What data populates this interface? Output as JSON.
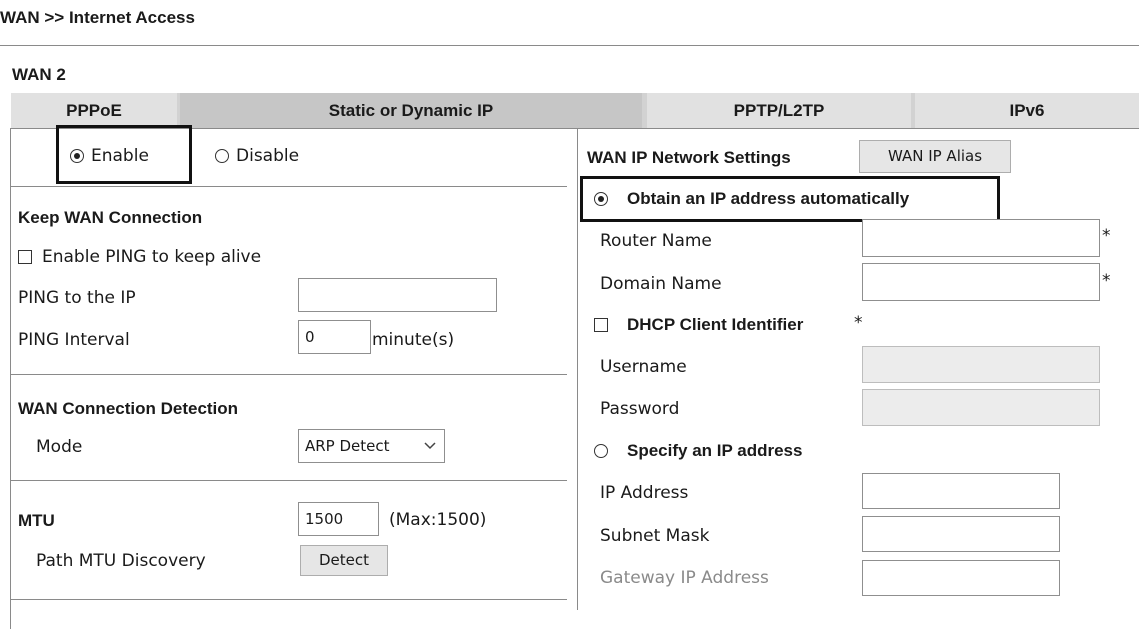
{
  "breadcrumb": "WAN >> Internet Access",
  "wan_label": "WAN 2",
  "tabs": [
    "PPPoE",
    "Static or Dynamic IP",
    "PPTP/L2TP",
    "IPv6"
  ],
  "enable_group": {
    "enable": "Enable",
    "disable": "Disable",
    "selected": "Enable"
  },
  "keep_wan": {
    "heading": "Keep WAN Connection",
    "ping_checkbox": "Enable PING to keep alive",
    "ping_ip_label": "PING to the IP",
    "ping_ip_value": "",
    "interval_label": "PING Interval",
    "interval_value": "0",
    "interval_unit": "minute(s)"
  },
  "detection": {
    "heading": "WAN Connection Detection",
    "mode_label": "Mode",
    "mode_value": "ARP Detect"
  },
  "mtu": {
    "label": "MTU",
    "value": "1500",
    "max": "(Max:1500)",
    "path_label": "Path MTU Discovery",
    "detect_button": "Detect"
  },
  "right": {
    "heading": "WAN IP Network Settings",
    "alias_button": "WAN IP Alias",
    "obtain_label": "Obtain an IP address automatically",
    "router_name_label": "Router Name",
    "domain_name_label": "Domain Name",
    "required_mark": "*",
    "dhcp_label": "DHCP Client Identifier",
    "username_label": "Username",
    "password_label": "Password",
    "specify_label": "Specify an IP address",
    "ip_address_label": "IP Address",
    "subnet_mask_label": "Subnet Mask",
    "gateway_label": "Gateway IP Address"
  }
}
